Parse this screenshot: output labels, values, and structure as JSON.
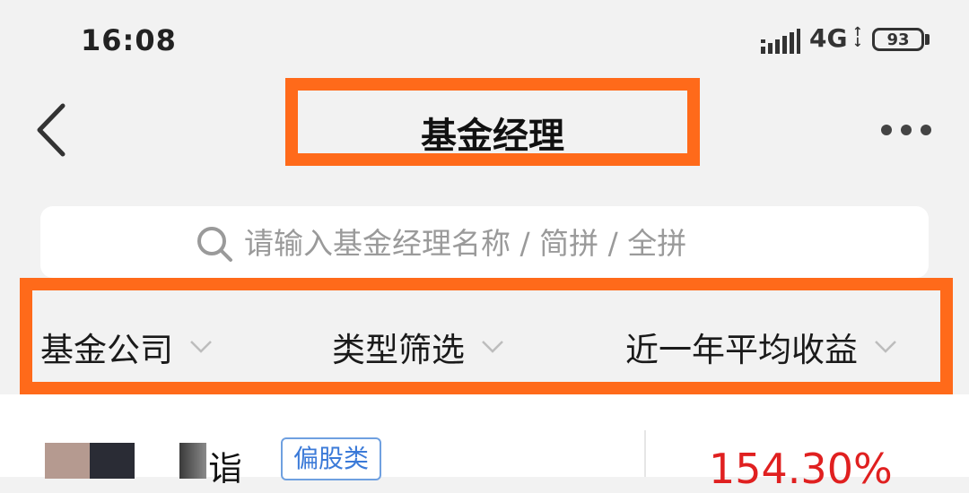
{
  "status_bar": {
    "time": "16:08",
    "network": "4G",
    "battery_level": "93",
    "icons": [
      "signal-icon",
      "network-arrows-icon",
      "battery-icon"
    ]
  },
  "nav": {
    "title": "基金经理",
    "icons": [
      "back-arrow-icon",
      "more-dots-icon"
    ]
  },
  "search": {
    "placeholder": "请输入基金经理名称 / 简拼 / 全拼",
    "icon": "search-icon"
  },
  "filters": [
    {
      "label": "基金公司"
    },
    {
      "label": "类型筛选"
    },
    {
      "label": "近一年平均收益"
    }
  ],
  "list": {
    "items": [
      {
        "name_visible": "诣",
        "type": "偏股类",
        "return": "154.30%"
      }
    ]
  },
  "colors": {
    "highlight": "#ff6a1a",
    "return_red": "#e02020",
    "badge_blue": "#3b7ad8"
  }
}
